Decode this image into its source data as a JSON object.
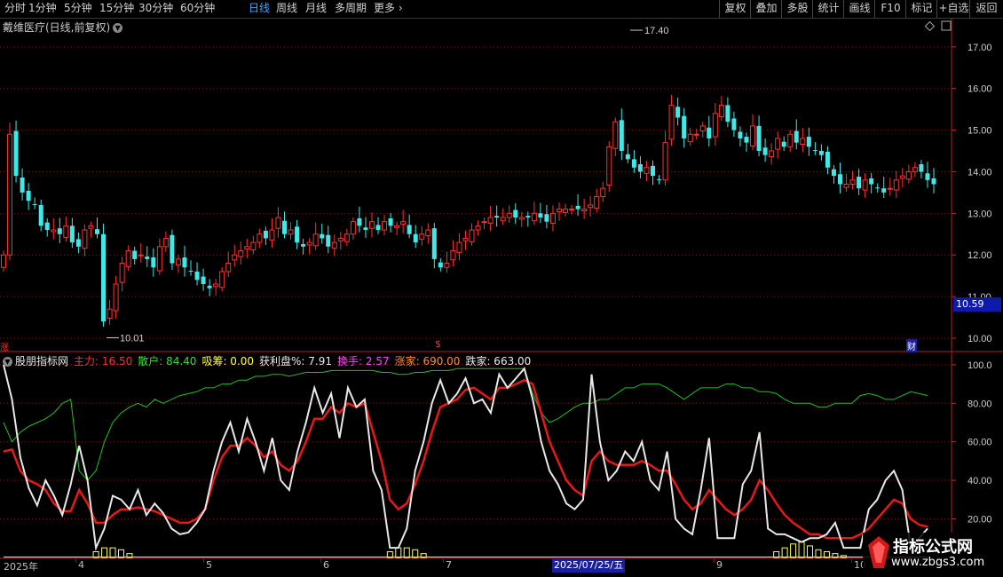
{
  "toolbar": {
    "timeframes": [
      "分时",
      "1分钟",
      "5分钟",
      "15分钟",
      "30分钟",
      "60分钟",
      "日线",
      "周线",
      "月线",
      "多周期",
      "更多"
    ],
    "active": "日线",
    "right_buttons": [
      "复权",
      "叠加",
      "多股",
      "统计",
      "画线",
      "F10",
      "标记",
      "+自选",
      "返回"
    ]
  },
  "stock_title": "戴维医疗(日线,前复权)",
  "price_axis": [
    "17.00",
    "16.00",
    "15.00",
    "14.00",
    "13.00",
    "12.00",
    "11.00",
    "10.00"
  ],
  "current_price": "10.59",
  "high_label": "17.40",
  "low_label": "10.01",
  "markers": {
    "left_badge": "涨",
    "dollar": "$",
    "finance": "财"
  },
  "indicator": {
    "name": "股朋指标网",
    "items": [
      {
        "label": "主力:",
        "value": "16.50",
        "color": "#ff3030"
      },
      {
        "label": "散户:",
        "value": "84.40",
        "color": "#30e030"
      },
      {
        "label": "吸筹:",
        "value": "0.00",
        "color": "#ffff40"
      },
      {
        "label": "获利盘%:",
        "value": "7.91",
        "color": "#e8e8e8"
      },
      {
        "label": "换手:",
        "value": "2.57",
        "color": "#ff40ff"
      },
      {
        "label": "涨家:",
        "value": "690.00",
        "color": "#ff8c30"
      },
      {
        "label": "跌家:",
        "value": "663.00",
        "color": "#e8e8e8"
      }
    ]
  },
  "indicator_axis": [
    "100.0",
    "80.00",
    "60.00",
    "40.00",
    "20.00"
  ],
  "date_axis": [
    "2025年",
    "4",
    "5",
    "6",
    "7",
    "9",
    "10"
  ],
  "date_highlight": "2025/07/25/五",
  "watermark": {
    "title": "指标公式网",
    "url": "www.zbgs3.com"
  },
  "colors": {
    "up": "#ff3030",
    "down": "#40e8e8",
    "grid": "#7a1a1a",
    "main_line": "#e8e8e8",
    "red_line": "#e81818",
    "green_line": "#20c020",
    "yellow": "#ffff40"
  },
  "chart_data": [
    {
      "type": "candlestick",
      "title": "戴维医疗(日线,前复权)",
      "ylim": [
        9.7,
        17.7
      ],
      "close": [
        12.0,
        14.9,
        13.9,
        13.5,
        13.3,
        13.2,
        12.7,
        12.6,
        12.6,
        12.5,
        12.7,
        12.3,
        12.2,
        12.6,
        12.7,
        12.5,
        10.4,
        10.7,
        11.3,
        11.8,
        12.1,
        11.9,
        12.0,
        11.9,
        11.7,
        12.2,
        12.4,
        11.8,
        11.9,
        11.7,
        11.6,
        11.4,
        11.3,
        11.2,
        11.3,
        11.6,
        11.8,
        12.0,
        12.1,
        12.2,
        12.3,
        12.5,
        12.4,
        12.6,
        12.9,
        12.5,
        12.6,
        12.3,
        12.2,
        12.3,
        12.5,
        12.4,
        12.2,
        12.3,
        12.4,
        12.5,
        12.8,
        12.7,
        12.6,
        12.8,
        12.6,
        12.8,
        12.7,
        12.7,
        12.8,
        12.5,
        12.3,
        12.5,
        12.6,
        11.9,
        11.7,
        11.8,
        12.1,
        12.3,
        12.4,
        12.6,
        12.7,
        12.8,
        12.9,
        12.9,
        12.9,
        13.0,
        12.9,
        12.9,
        12.9,
        13.0,
        12.9,
        12.8,
        13.0,
        13.1,
        13.1,
        13.1,
        13.1,
        13.1,
        13.2,
        13.4,
        13.6,
        14.6,
        15.2,
        14.5,
        14.3,
        14.1,
        14.0,
        14.1,
        13.9,
        13.8,
        14.7,
        15.6,
        15.3,
        14.8,
        14.9,
        14.9,
        15.1,
        14.8,
        15.4,
        15.6,
        15.2,
        15.0,
        14.8,
        14.7,
        15.1,
        14.5,
        14.4,
        14.5,
        14.8,
        14.6,
        14.9,
        14.7,
        14.8,
        14.6,
        14.5,
        14.4,
        14.1,
        13.9,
        13.7,
        13.7,
        13.8,
        13.6,
        13.8,
        13.7,
        13.6,
        13.5,
        13.6,
        13.8,
        13.9,
        14.0,
        14.1,
        14.0,
        13.8,
        13.7
      ]
    },
    {
      "type": "line",
      "name": "股朋指标网",
      "ylim": [
        0,
        105
      ],
      "series": [
        {
          "name": "白线",
          "values": [
            100,
            82,
            52,
            36,
            27,
            40,
            32,
            22,
            38,
            58,
            40,
            5,
            15,
            32,
            30,
            25,
            35,
            22,
            28,
            23,
            15,
            12,
            13,
            18,
            25,
            45,
            60,
            70,
            55,
            72,
            60,
            45,
            62,
            40,
            35,
            55,
            70,
            88,
            75,
            85,
            62,
            88,
            78,
            82,
            45,
            35,
            5,
            5,
            15,
            45,
            60,
            80,
            92,
            80,
            85,
            93,
            80,
            82,
            75,
            95,
            88,
            93,
            98,
            82,
            60,
            45,
            38,
            28,
            25,
            30,
            95,
            60,
            40,
            45,
            55,
            50,
            60,
            40,
            35,
            55,
            20,
            15,
            12,
            35,
            62,
            10,
            10,
            10,
            38,
            45,
            65,
            15,
            12,
            12,
            10,
            8,
            10,
            10,
            12,
            18,
            5,
            5,
            5,
            25,
            30,
            40,
            45,
            35,
            5,
            10,
            15
          ]
        },
        {
          "name": "主力",
          "values": [
            55,
            56,
            45,
            40,
            38,
            35,
            28,
            24,
            24,
            35,
            28,
            18,
            18,
            22,
            25,
            25,
            26,
            25,
            24,
            22,
            20,
            18,
            18,
            20,
            25,
            40,
            52,
            58,
            58,
            62,
            58,
            52,
            55,
            48,
            45,
            50,
            60,
            72,
            72,
            78,
            75,
            80,
            78,
            80,
            65,
            50,
            30,
            25,
            28,
            38,
            50,
            65,
            78,
            80,
            82,
            87,
            88,
            85,
            82,
            88,
            88,
            90,
            92,
            90,
            75,
            60,
            50,
            40,
            35,
            32,
            50,
            55,
            50,
            48,
            48,
            48,
            50,
            48,
            45,
            45,
            38,
            30,
            25,
            28,
            35,
            30,
            25,
            22,
            25,
            30,
            40,
            35,
            28,
            22,
            18,
            15,
            12,
            12,
            10,
            10,
            10,
            10,
            12,
            15,
            20,
            25,
            30,
            28,
            20,
            17,
            16
          ]
        },
        {
          "name": "散户",
          "values": [
            70,
            60,
            65,
            68,
            70,
            72,
            75,
            80,
            82,
            45,
            40,
            45,
            60,
            70,
            75,
            78,
            80,
            78,
            82,
            80,
            82,
            84,
            85,
            86,
            88,
            88,
            90,
            90,
            92,
            92,
            94,
            94,
            95,
            95,
            94,
            95,
            96,
            96,
            96,
            97,
            97,
            97,
            97,
            97,
            97,
            96,
            96,
            95,
            95,
            96,
            96,
            97,
            97,
            97,
            98,
            98,
            98,
            98,
            98,
            98,
            98,
            98,
            98,
            85,
            75,
            70,
            72,
            75,
            78,
            80,
            80,
            82,
            82,
            85,
            88,
            88,
            90,
            90,
            90,
            88,
            85,
            82,
            85,
            88,
            88,
            88,
            90,
            90,
            88,
            88,
            86,
            86,
            85,
            82,
            80,
            80,
            80,
            78,
            78,
            80,
            80,
            80,
            84,
            85,
            84,
            82,
            82,
            84,
            86,
            85,
            84
          ]
        },
        {
          "name": "吸筹",
          "values": [
            0,
            0,
            0,
            0,
            0,
            0,
            0,
            0,
            0,
            0,
            0,
            3,
            5,
            5,
            4,
            2,
            0,
            0,
            0,
            0,
            0,
            0,
            0,
            0,
            0,
            0,
            0,
            0,
            0,
            0,
            0,
            0,
            0,
            0,
            0,
            0,
            0,
            0,
            0,
            0,
            0,
            0,
            0,
            0,
            0,
            0,
            3,
            5,
            5,
            4,
            2,
            0,
            0,
            0,
            0,
            0,
            0,
            0,
            0,
            0,
            0,
            0,
            0,
            0,
            0,
            0,
            0,
            0,
            0,
            0,
            0,
            0,
            0,
            0,
            0,
            0,
            0,
            0,
            0,
            0,
            0,
            0,
            0,
            0,
            0,
            0,
            0,
            0,
            0,
            0,
            0,
            0,
            3,
            5,
            7,
            8,
            6,
            4,
            3,
            2,
            1,
            0,
            0,
            0,
            0,
            0,
            0,
            0,
            0,
            0,
            0
          ]
        }
      ]
    }
  ]
}
